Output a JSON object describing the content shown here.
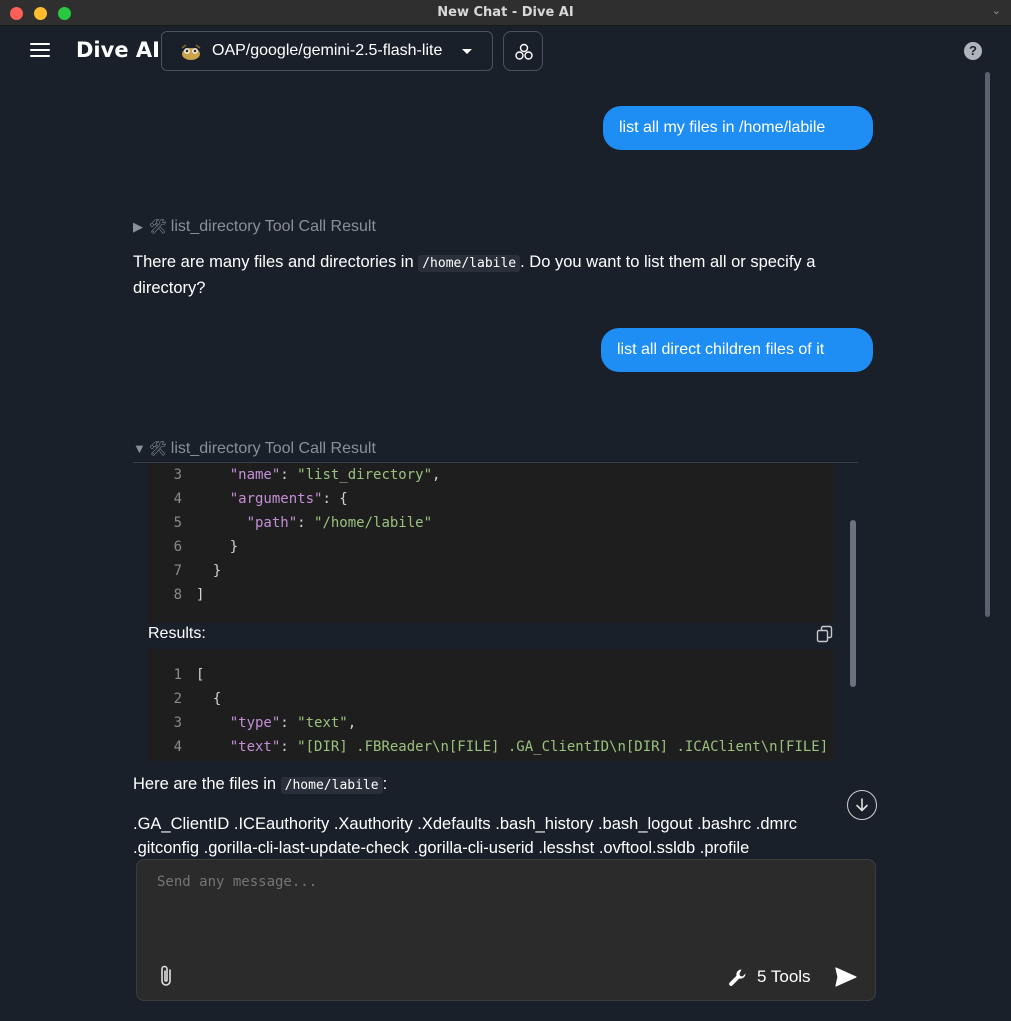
{
  "window": {
    "title": "New Chat - Dive AI",
    "menu_glyph": "⌄"
  },
  "header": {
    "brand": "Dive AI",
    "model": "OAP/google/gemini-2.5-flash-lite",
    "help": "?"
  },
  "messages": {
    "user1": "list all my files in /home/labile",
    "tool1_label": "list_directory Tool Call Result",
    "tool1_arrow": "▶",
    "assistant1_pre": "There are many files and directories in ",
    "assistant1_code": "/home/labile",
    "assistant1_post": ". Do you want to list them all or specify a directory?",
    "user2": "list all direct children files of it",
    "tool2_label": "list_directory Tool Call Result",
    "tool2_arrow": "▼",
    "results_label": "Results:",
    "assistant2_pre": "Here are the files in ",
    "assistant2_code": "/home/labile",
    "assistant2_post": ":",
    "file_list_line1": ".GA_ClientID .ICEauthority .Xauthority .Xdefaults .bash_history .bash_logout .bashrc .dmrc",
    "file_list_line2": ".gitconfig .gorilla-cli-last-update-check .gorilla-cli-userid .lesshst .ovftool.ssldb .profile"
  },
  "code_args": [
    {
      "n": "3",
      "indent": "    ",
      "key": "\"name\"",
      "sep": ": ",
      "val": "\"list_directory\"",
      "end": ","
    },
    {
      "n": "4",
      "indent": "    ",
      "key": "\"arguments\"",
      "sep": ": ",
      "val": "",
      "end": "{"
    },
    {
      "n": "5",
      "indent": "      ",
      "key": "\"path\"",
      "sep": ": ",
      "val": "\"/home/labile\"",
      "end": ""
    },
    {
      "n": "6",
      "indent": "    ",
      "key": "",
      "sep": "",
      "val": "",
      "end": "}"
    },
    {
      "n": "7",
      "indent": "  ",
      "key": "",
      "sep": "",
      "val": "",
      "end": "}"
    },
    {
      "n": "8",
      "indent": "",
      "key": "",
      "sep": "",
      "val": "",
      "end": "]"
    }
  ],
  "code_results": [
    {
      "n": "1",
      "indent": "",
      "key": "",
      "sep": "",
      "val": "",
      "end": "["
    },
    {
      "n": "2",
      "indent": "  ",
      "key": "",
      "sep": "",
      "val": "",
      "end": "{"
    },
    {
      "n": "3",
      "indent": "    ",
      "key": "\"type\"",
      "sep": ": ",
      "val": "\"text\"",
      "end": ","
    },
    {
      "n": "4",
      "indent": "    ",
      "key": "\"text\"",
      "sep": ": ",
      "val": "\"[DIR] .FBReader\\n[FILE] .GA_ClientID\\n[DIR] .ICAClient\\n[FILE]",
      "end": ""
    }
  ],
  "composer": {
    "placeholder": "Send any message...",
    "tools_label": "5 Tools"
  },
  "icons": {
    "wrench": "🛠"
  }
}
